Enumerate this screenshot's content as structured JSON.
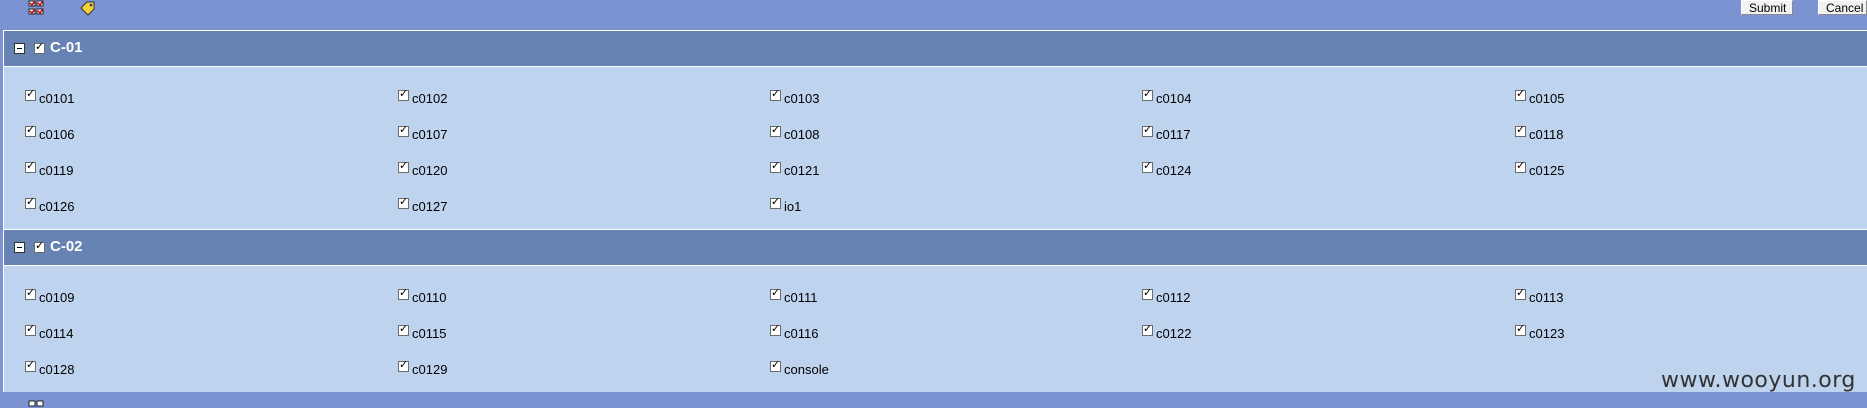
{
  "toolbar": {
    "icons": [
      "select-all-icon",
      "tag-icon"
    ],
    "submit_label": "Submit",
    "cancel_label": "Cancel"
  },
  "groups": [
    {
      "title": "C-01",
      "checked": true,
      "items": [
        {
          "label": "c0101",
          "checked": true
        },
        {
          "label": "c0102",
          "checked": true
        },
        {
          "label": "c0103",
          "checked": true
        },
        {
          "label": "c0104",
          "checked": true
        },
        {
          "label": "c0105",
          "checked": true
        },
        {
          "label": "c0106",
          "checked": true
        },
        {
          "label": "c0107",
          "checked": true
        },
        {
          "label": "c0108",
          "checked": true
        },
        {
          "label": "c0117",
          "checked": true
        },
        {
          "label": "c0118",
          "checked": true
        },
        {
          "label": "c0119",
          "checked": true
        },
        {
          "label": "c0120",
          "checked": true
        },
        {
          "label": "c0121",
          "checked": true
        },
        {
          "label": "c0124",
          "checked": true
        },
        {
          "label": "c0125",
          "checked": true
        },
        {
          "label": "c0126",
          "checked": true
        },
        {
          "label": "c0127",
          "checked": true
        },
        {
          "label": "io1",
          "checked": true
        }
      ]
    },
    {
      "title": "C-02",
      "checked": true,
      "items": [
        {
          "label": "c0109",
          "checked": true
        },
        {
          "label": "c0110",
          "checked": true
        },
        {
          "label": "c0111",
          "checked": true
        },
        {
          "label": "c0112",
          "checked": true
        },
        {
          "label": "c0113",
          "checked": true
        },
        {
          "label": "c0114",
          "checked": true
        },
        {
          "label": "c0115",
          "checked": true
        },
        {
          "label": "c0116",
          "checked": true
        },
        {
          "label": "c0122",
          "checked": true
        },
        {
          "label": "c0123",
          "checked": true
        },
        {
          "label": "c0128",
          "checked": true
        },
        {
          "label": "c0129",
          "checked": true
        },
        {
          "label": "console",
          "checked": true
        }
      ]
    }
  ],
  "watermark": "www.wooyun.org",
  "colors": {
    "page_background": "#7b93d0",
    "group_header": "#6683b4",
    "group_body": "#bed3ee"
  }
}
